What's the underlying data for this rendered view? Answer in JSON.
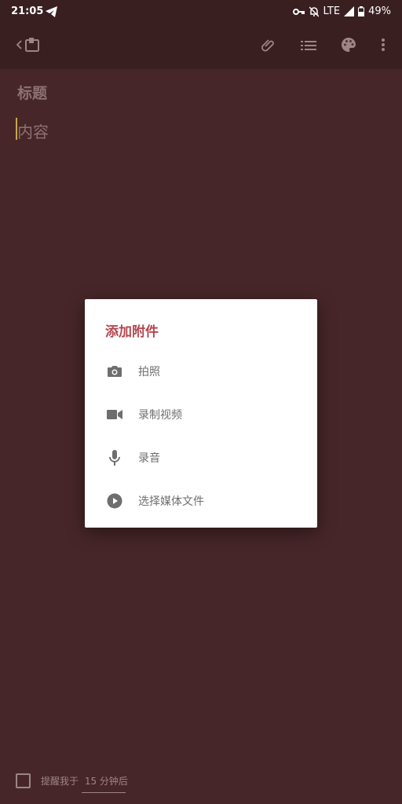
{
  "status_bar": {
    "time": "21:05",
    "network": "LTE",
    "battery": "49%"
  },
  "toolbar": {
    "back_icon": "chevron-left-icon",
    "app_icon": "notebook-icon",
    "attach_icon": "paperclip-icon",
    "list_icon": "checklist-icon",
    "palette_icon": "palette-icon",
    "more_icon": "more-vert-icon"
  },
  "note": {
    "title_placeholder": "标题",
    "content_placeholder": "内容"
  },
  "dialog": {
    "title": "添加附件",
    "options": [
      {
        "label": "拍照",
        "icon": "camera-icon"
      },
      {
        "label": "录制视频",
        "icon": "video-icon"
      },
      {
        "label": "录音",
        "icon": "mic-icon"
      },
      {
        "label": "选择媒体文件",
        "icon": "play-circle-icon"
      }
    ]
  },
  "reminder": {
    "label": "提醒我于",
    "time": "15 分钟后"
  },
  "colors": {
    "background": "#472629",
    "accent": "#b5474f"
  }
}
